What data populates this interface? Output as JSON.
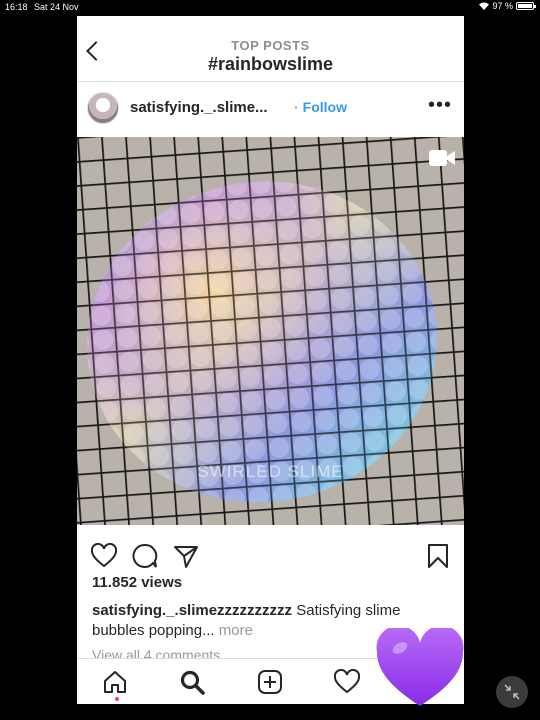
{
  "status_bar": {
    "time": "16:18",
    "date": "Sat 24 Nov",
    "battery": "97 %",
    "battery_level": 0.97
  },
  "header": {
    "kicker": "TOP POSTS",
    "hashtag": "#rainbowslime"
  },
  "post": {
    "username": "satisfying._.slime...",
    "follow_label": "Follow",
    "media_watermark": "SWIRLED SLIME",
    "views": "11.852 views",
    "caption_user": "satisfying._.slimezzzzzzzzzz",
    "caption_text": " Satisfying slime bubbles popping...",
    "caption_more": " more",
    "comments_link": "View all 4 comments"
  },
  "icons": {
    "back": "chevron-left-icon",
    "more": "ellipsis-icon",
    "video": "video-camera-icon",
    "like": "heart-icon",
    "comment": "comment-icon",
    "share": "paper-plane-icon",
    "save": "bookmark-icon",
    "home": "home-icon",
    "search": "search-icon",
    "add": "add-post-icon",
    "activity": "heart-icon",
    "overlay": "purple-heart-emoji",
    "minimize": "minimize-icon"
  },
  "colors": {
    "link": "#3897f0",
    "text": "#262626",
    "muted": "#8e8e8e",
    "heart": "#9b3ff2"
  }
}
